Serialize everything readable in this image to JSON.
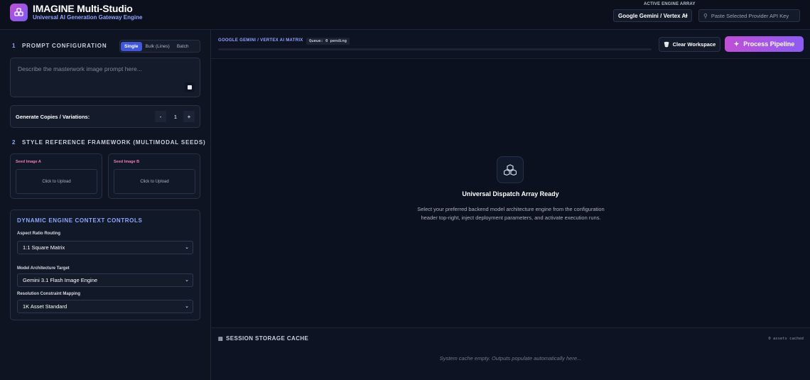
{
  "header": {
    "title": "IMAGINE Multi-Studio",
    "subtitle": "Universal AI Generation Gateway Engine",
    "engine_label": "ACTIVE ENGINE ARRAY",
    "engine_selected": "Google Gemini / Vertex AI",
    "api_key_placeholder": "Paste Selected Provider API Key"
  },
  "prompt_section": {
    "number": "1",
    "title": "PROMPT CONFIGURATION",
    "modes": [
      "Single",
      "Bulk (Lines)",
      "Batch"
    ],
    "active_mode": "Single",
    "prompt_placeholder": "Describe the masterwork image prompt here...",
    "copies_label": "Generate Copies / Variations:",
    "minus": "-",
    "plus": "+",
    "copies_value": "1"
  },
  "style_section": {
    "number": "2",
    "title": "STYLE REFERENCE FRAMEWORK (MULTIMODAL SEEDS)",
    "seeds": [
      {
        "label": "Seed Image A",
        "upload": "Click to Upload"
      },
      {
        "label": "Seed Image B",
        "upload": "Click to Upload"
      }
    ]
  },
  "controls": {
    "title": "DYNAMIC ENGINE CONTEXT CONTROLS",
    "aspect_label": "Aspect Ratio Routing",
    "aspect_value": "1:1 Square Matrix",
    "model_label": "Model Architecture Target",
    "model_value": "Gemini 3.1 Flash Image Engine",
    "resolution_label": "Resolution Constraint Mapping",
    "resolution_value": "1K Asset Standard"
  },
  "main": {
    "matrix_label": "GOOGLE GEMINI / VERTEX AI MATRIX",
    "queue": "Queue: 0 pending",
    "progress": 0,
    "clear_label": "Clear Workspace",
    "run_label": "Process Pipeline",
    "ready_title": "Universal Dispatch Array Ready",
    "ready_desc": "Select your preferred backend model architecture engine from the configuration header top-right, inject deployment parameters, and activate execution runs."
  },
  "cache": {
    "title": "SESSION STORAGE CACHE",
    "count": "0 assets cached",
    "empty": "System cache empty. Outputs populate automatically here..."
  },
  "colors": {
    "accent_purple": "#c04fd6",
    "accent_blue": "#8fa6ff",
    "seed_pink": "#f07bb0",
    "tab_active": "#3f57d8"
  },
  "icons": {
    "logo": "palette-icon",
    "key": "key-icon",
    "clear": "trash-icon",
    "run": "magic-wand-icon",
    "center": "cubes-icon",
    "cache": "database-icon",
    "send": "stop-square-icon",
    "chevron": "chevron-down-icon"
  }
}
